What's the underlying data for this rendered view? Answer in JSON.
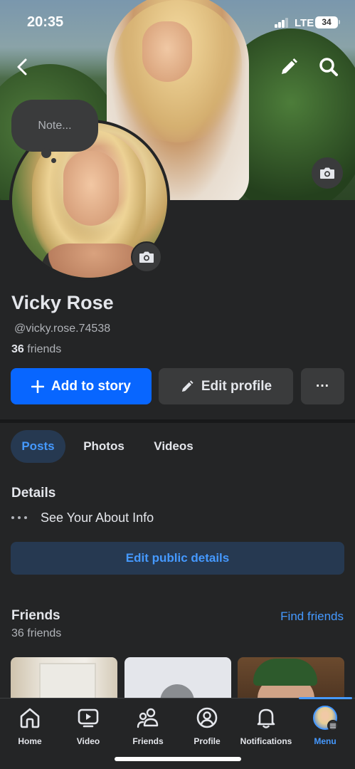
{
  "status_bar": {
    "time": "20:35",
    "network": "LTE",
    "battery": "34"
  },
  "cover": {
    "note_placeholder": "Note..."
  },
  "profile": {
    "name": "Vicky Rose",
    "username": "@vicky.rose.74538",
    "friends_count": "36",
    "friends_label": "friends"
  },
  "actions": {
    "add_to_story": "Add to story",
    "edit_profile": "Edit profile",
    "more": "···"
  },
  "tabs": [
    {
      "label": "Posts",
      "active": true
    },
    {
      "label": "Photos",
      "active": false
    },
    {
      "label": "Videos",
      "active": false
    }
  ],
  "details": {
    "title": "Details",
    "about": "See Your About Info",
    "edit_public": "Edit public details"
  },
  "friends": {
    "title": "Friends",
    "find": "Find friends",
    "count_text": "36 friends"
  },
  "bottom_nav": [
    {
      "label": "Home",
      "icon": "home-icon"
    },
    {
      "label": "Video",
      "icon": "video-icon"
    },
    {
      "label": "Friends",
      "icon": "friends-icon"
    },
    {
      "label": "Profile",
      "icon": "profile-icon"
    },
    {
      "label": "Notifications",
      "icon": "bell-icon"
    },
    {
      "label": "Menu",
      "icon": "menu-avatar",
      "active": true
    }
  ],
  "colors": {
    "background": "#242526",
    "accent": "#0866ff",
    "link": "#4599ff",
    "surface": "#3a3b3c"
  }
}
